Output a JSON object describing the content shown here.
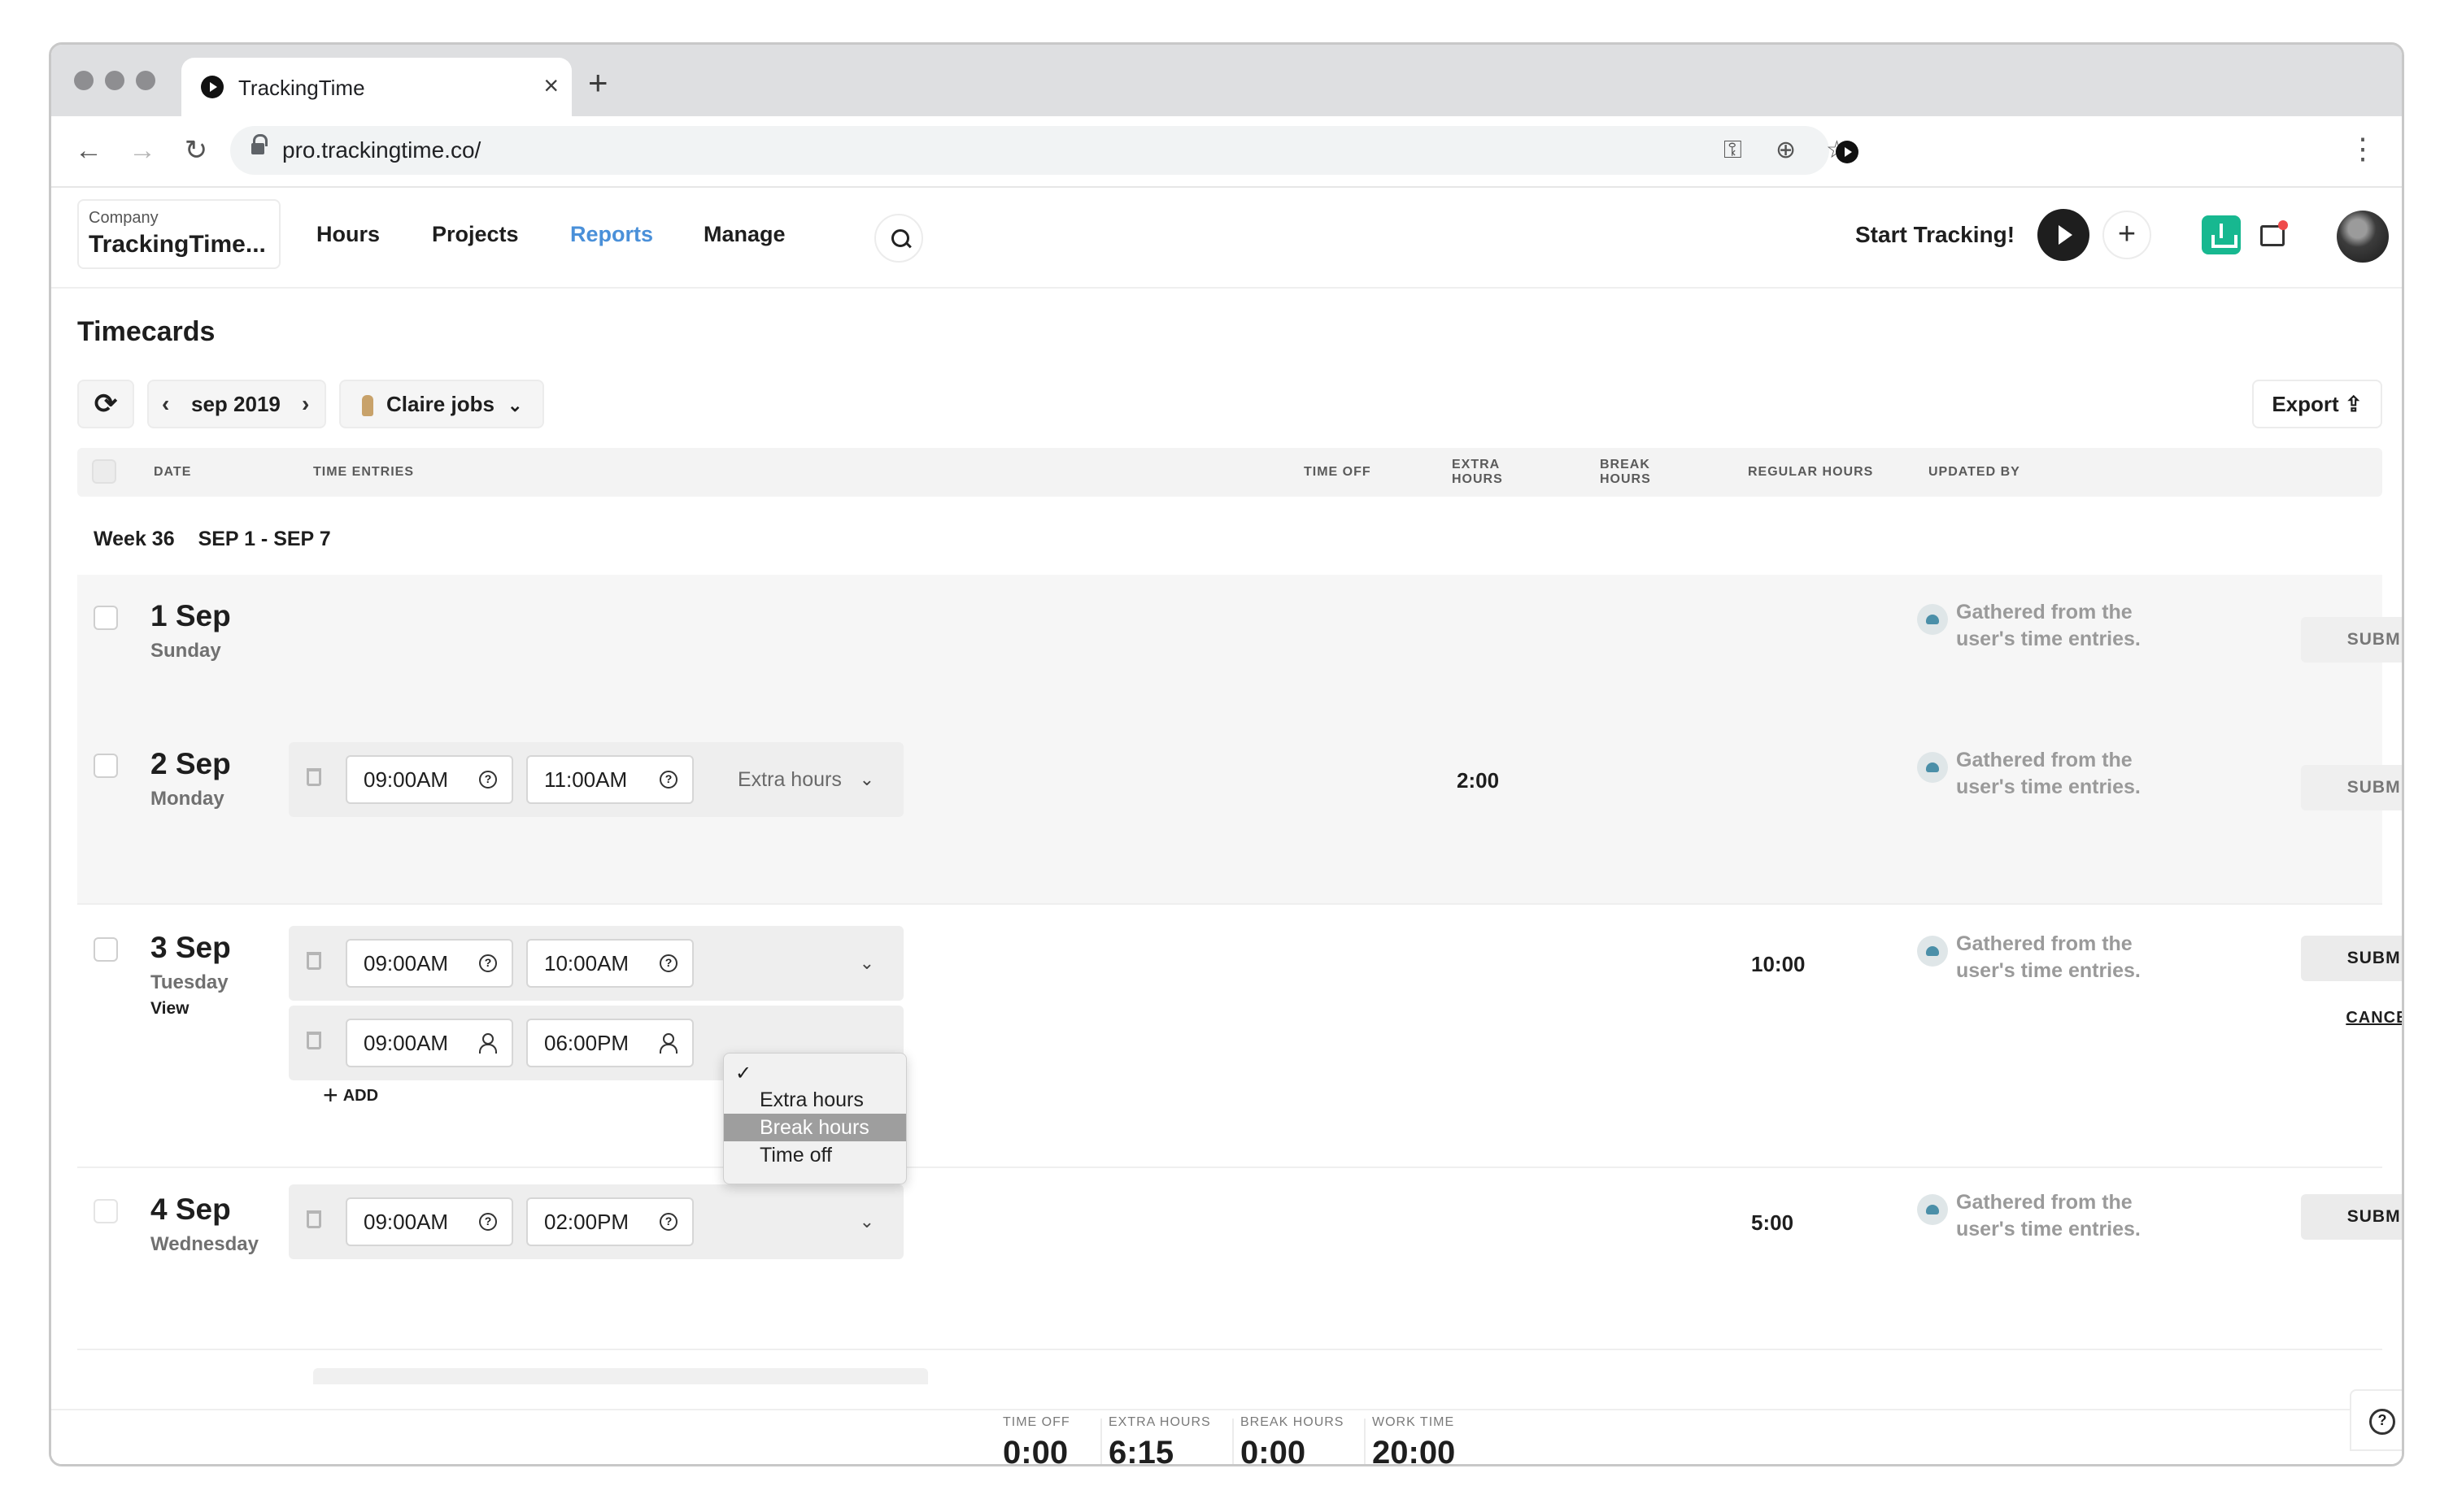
{
  "browser": {
    "tab_title": "TrackingTime",
    "url": "pro.trackingtime.co/",
    "new_tab": "+",
    "close": "×"
  },
  "header": {
    "company_label": "Company",
    "company_name": "TrackingTime...",
    "nav": [
      "Hours",
      "Projects",
      "Reports",
      "Manage"
    ],
    "active_nav": "Reports",
    "start_label": "Start Tracking!",
    "accent_color": "#4a90d9",
    "download_color": "#17b890"
  },
  "page": {
    "title": "Timecards",
    "month": "sep 2019",
    "user": "Claire jobs",
    "export": "Export"
  },
  "columns": [
    "DATE",
    "TIME ENTRIES",
    "TIME OFF",
    "EXTRA HOURS",
    "BREAK HOURS",
    "REGULAR HOURS",
    "UPDATED BY"
  ],
  "week": {
    "label": "Week 36",
    "range": "SEP 1 - SEP 7"
  },
  "days": [
    {
      "num": "1 Sep",
      "name": "Sunday",
      "gathered_1": "Gathered from the",
      "gathered_2": "user's time entries.",
      "submit": "SUBMIT"
    },
    {
      "num": "2 Sep",
      "name": "Monday",
      "start": "09:00AM",
      "end": "11:00AM",
      "type": "Extra hours",
      "extra": "2:00",
      "gathered_1": "Gathered from the",
      "gathered_2": "user's time entries.",
      "submit": "SUBMIT"
    },
    {
      "num": "3 Sep",
      "name": "Tuesday",
      "view": "View",
      "start": "09:00AM",
      "end": "10:00AM",
      "start2": "09:00AM",
      "end2": "06:00PM",
      "regular": "10:00",
      "gathered_1": "Gathered from the",
      "gathered_2": "user's time entries.",
      "submit": "SUBMIT",
      "cancel": "CANCEL",
      "add": "ADD"
    },
    {
      "num": "4 Sep",
      "name": "Wednesday",
      "start": "09:00AM",
      "end": "02:00PM",
      "regular": "5:00",
      "gathered_1": "Gathered from the",
      "gathered_2": "user's time entries.",
      "submit": "SUBMIT"
    }
  ],
  "dropdown": {
    "check": "✓",
    "options": [
      "Extra hours",
      "Break hours",
      "Time off"
    ],
    "highlighted": "Break hours"
  },
  "totals": [
    {
      "label": "TIME OFF",
      "value": "0:00"
    },
    {
      "label": "EXTRA HOURS",
      "value": "6:15"
    },
    {
      "label": "BREAK HOURS",
      "value": "0:00"
    },
    {
      "label": "WORK TIME",
      "value": "20:00"
    }
  ]
}
